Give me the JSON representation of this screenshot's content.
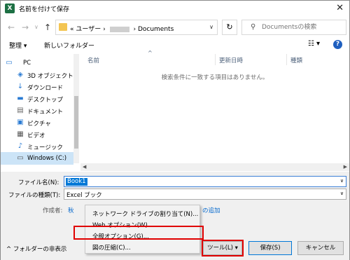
{
  "window": {
    "title": "名前を付けて保存",
    "app_icon": "X",
    "close_glyph": "✕"
  },
  "address": {
    "crumbs_prefix": "«",
    "crumb1": "ユーザー",
    "crumb_sep": "›",
    "crumb3": "Documents",
    "dropdown_glyph": "∨",
    "refresh_glyph": "↻"
  },
  "search": {
    "placeholder": "Documentsの検索"
  },
  "toolbar": {
    "organize": "整理 ▾",
    "new_folder": "新しいフォルダー",
    "help_glyph": "?"
  },
  "nav": {
    "items": [
      {
        "label": "PC",
        "icon": "pc-icon"
      },
      {
        "label": "3D オブジェクト",
        "icon": "3d-objects-icon"
      },
      {
        "label": "ダウンロード",
        "icon": "download-icon"
      },
      {
        "label": "デスクトップ",
        "icon": "desktop-icon"
      },
      {
        "label": "ドキュメント",
        "icon": "document-icon"
      },
      {
        "label": "ピクチャ",
        "icon": "pictures-icon"
      },
      {
        "label": "ビデオ",
        "icon": "video-icon"
      },
      {
        "label": "ミュージック",
        "icon": "music-icon"
      },
      {
        "label": "Windows (C:)",
        "icon": "drive-icon"
      }
    ]
  },
  "filelist": {
    "columns": [
      "名前",
      "更新日時",
      "種類"
    ],
    "empty_message": "検索条件に一致する項目はありません。"
  },
  "form": {
    "filename_label": "ファイル名(N):",
    "filename_value": "Book1",
    "filetype_label": "ファイルの種類(T):",
    "filetype_value": "Excel ブック",
    "author_label": "作成者:",
    "author_value_partial": "秋",
    "tag_add_partial": "の追加"
  },
  "menu": {
    "items": [
      "ネットワーク ドライブの割り当て(N)...",
      "Web オプション(W)...",
      "全般オプション(G)...",
      "図の圧縮(C)..."
    ]
  },
  "footer": {
    "hide_folders": "フォルダーの非表示",
    "tools": "ツール(L)",
    "save": "保存(S)",
    "cancel": "キャンセル"
  },
  "colors": {
    "accent": "#0078d7",
    "highlight": "#e00000",
    "excel_green": "#1d7044"
  }
}
